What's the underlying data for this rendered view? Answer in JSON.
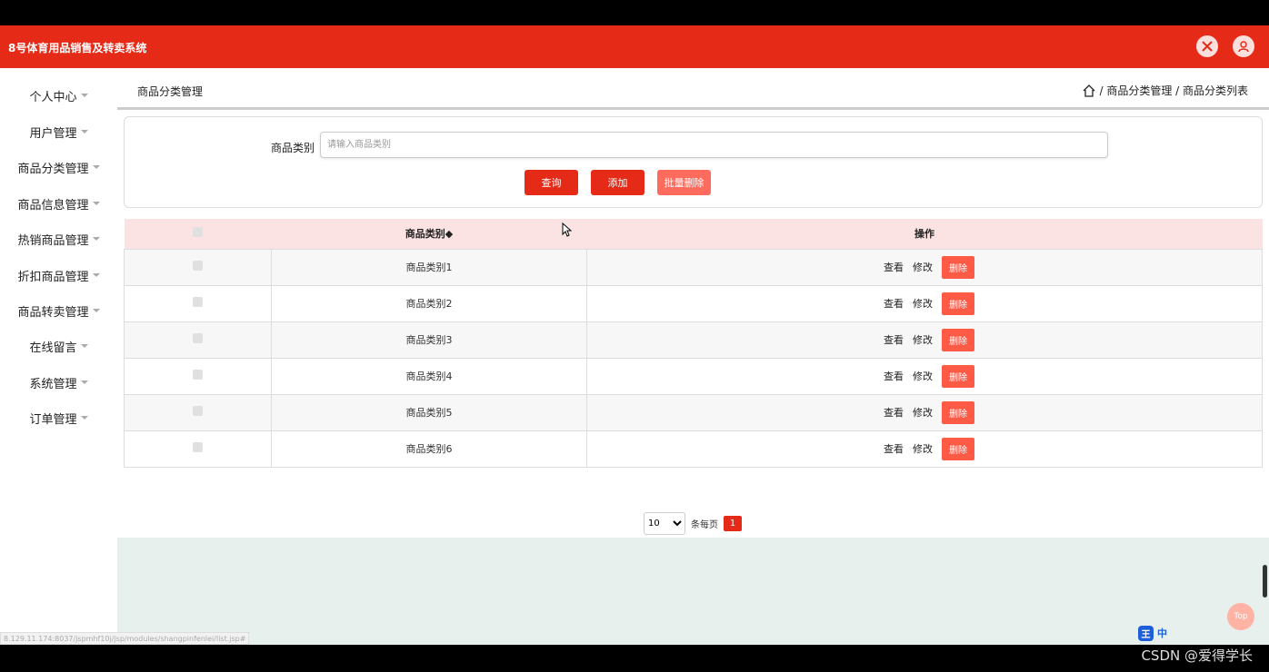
{
  "app": {
    "title": "8号体育用品销售及转卖系统"
  },
  "sidebar": {
    "items": [
      {
        "label": "个人中心"
      },
      {
        "label": "用户管理"
      },
      {
        "label": "商品分类管理"
      },
      {
        "label": "商品信息管理"
      },
      {
        "label": "热销商品管理"
      },
      {
        "label": "折扣商品管理"
      },
      {
        "label": "商品转卖管理"
      },
      {
        "label": "在线留言"
      },
      {
        "label": "系统管理"
      },
      {
        "label": "订单管理"
      }
    ]
  },
  "breadcrumb": {
    "title": "商品分类管理",
    "path": "/ 商品分类管理 / 商品分类列表"
  },
  "search": {
    "label": "商品类别",
    "placeholder": "请输入商品类别",
    "query_label": "查询",
    "add_label": "添加",
    "batch_delete_label": "批量删除"
  },
  "table": {
    "headers": {
      "name": "商品类别◆",
      "ops": "操作"
    },
    "rows": [
      {
        "name": "商品类别1"
      },
      {
        "name": "商品类别2"
      },
      {
        "name": "商品类别3"
      },
      {
        "name": "商品类别4"
      },
      {
        "name": "商品类别5"
      },
      {
        "name": "商品类别6"
      }
    ],
    "view_label": "查看",
    "edit_label": "修改",
    "delete_label": "删除"
  },
  "pager": {
    "page_size": "10",
    "per_page_label": "条每页",
    "current_page": "1"
  },
  "misc": {
    "top_label": "Top",
    "status_url": "8.129.11.174:8037/jspmhf10j/jsp/modules/shangpinfenlei/list.jsp#",
    "ime_logo": "王",
    "ime_mode": "中",
    "watermark": "CSDN @爱得学长"
  },
  "colors": {
    "brand": "#e52a17",
    "header_row": "#fbe3e3",
    "delete_button": "#ff5a46"
  }
}
